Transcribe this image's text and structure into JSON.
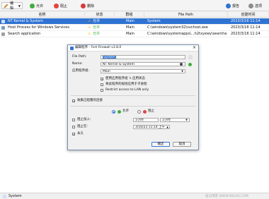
{
  "toolbar": {
    "edit_label": "编辑",
    "allow_label": "允许",
    "block_label": "阻止",
    "delete_label": "删除",
    "report_label": "报告",
    "options_label": "选项"
  },
  "table": {
    "columns": [
      "名称",
      "状态",
      "群组",
      "File Path",
      "创建时间"
    ],
    "rows": [
      {
        "name": "NT Kernel & System",
        "status": "允许",
        "group": "Main",
        "path": "System",
        "time": "2023/3/16 11:14"
      },
      {
        "name": "Host Process for Windows Services",
        "status": "允许",
        "group": "Main",
        "path": "C:\\windows\\system32\\svchost.exe",
        "time": "2023/3/16 11:14"
      },
      {
        "name": "Search application",
        "status": "允许",
        "group": "Main",
        "path": "C:\\windows\\systemapps\\...h2txyewy\\searchapp.exe",
        "time": "2023/3/16 11:14"
      }
    ]
  },
  "dialog": {
    "title": "编辑程序 - Fort Firewall v3.8.0",
    "file_path_label": "File Path:",
    "file_path_value": "System",
    "name_label": "Name:",
    "name_value": "NT Kernel & System",
    "group_label": "应用程序组:",
    "group_value": "Main",
    "opt_use_group": "使用应用程序组 's 启用状态",
    "opt_parent": "将此程序的规则应用于子进程",
    "opt_lan": "Restrict access to LAN only",
    "opt_collect": "收集已阻塞的连接",
    "radio_allow": "允许",
    "radio_block": "阻止",
    "block_in_label": "阻止加入:",
    "block_in_value": "1小时",
    "block_in_value2": "1小时",
    "block_label": "阻止在:",
    "block_date": "3/16/23 11:14 上午",
    "forever_label": "永久",
    "ok_label": "确定",
    "cancel_label": "取消"
  },
  "status": {
    "text": "System"
  },
  "watermark": "纽记博客 WWW.90LHD.COM",
  "colors": {
    "accent": "#2f73d2",
    "allow": "#3fae3b",
    "block": "#e0463c",
    "warn": "#f0b400"
  }
}
